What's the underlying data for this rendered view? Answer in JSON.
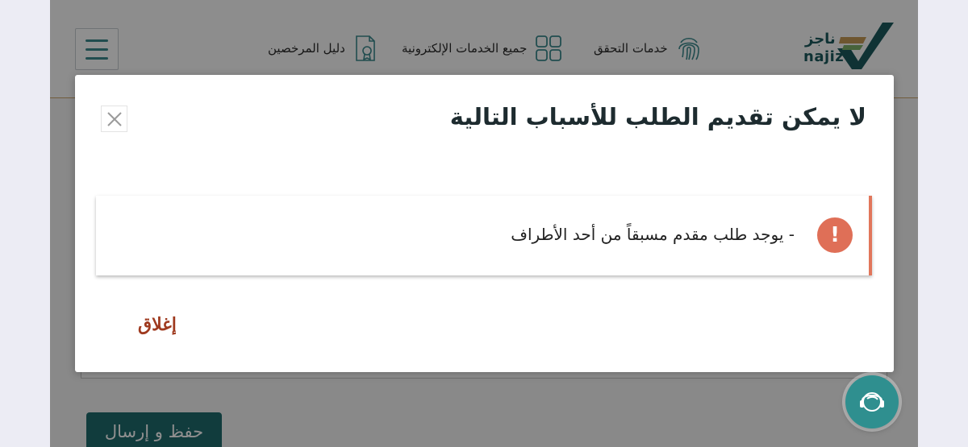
{
  "header": {
    "nav": [
      {
        "label": "خدمات التحقق",
        "icon": "fingerprint-icon"
      },
      {
        "label": "جميع الخدمات الإلكترونية",
        "icon": "grid-icon"
      },
      {
        "label": "دليل المرخصين",
        "icon": "certificate-icon"
      }
    ],
    "logo": {
      "ar": "ناجز",
      "en": "najiz"
    }
  },
  "page": {
    "submit_label": "حفظ و إرسال"
  },
  "modal": {
    "title": "لا يمكن تقديم الطلب للأسباب التالية",
    "alert": {
      "icon": "exclamation-icon",
      "text": "- يوجد طلب مقدم مسبقاً من أحد الأطراف"
    },
    "dismiss_label": "إغلاق"
  },
  "colors": {
    "brand_teal": "#1f6b6e",
    "alert_accent": "#df6f57",
    "dismiss_text": "#9f3a1f"
  }
}
